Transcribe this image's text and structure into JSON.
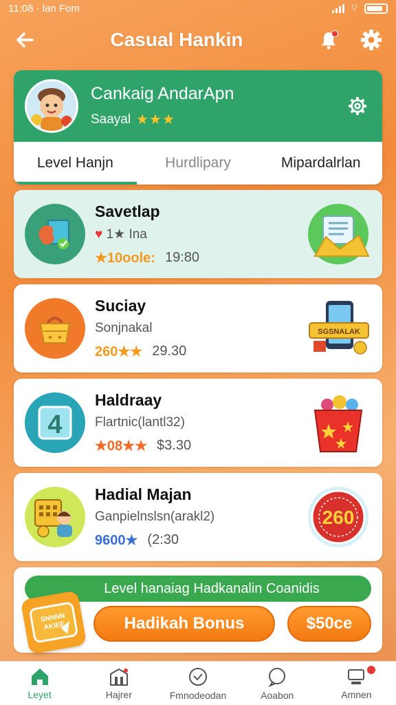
{
  "status_bar": {
    "time": "11:08 · lan Fom"
  },
  "app_bar": {
    "title": "Casual Hankin"
  },
  "profile": {
    "name": "Cankaig AndarApn",
    "subtitle": "Saayal",
    "stars": "★★★"
  },
  "tabs": [
    {
      "label": "Level Hanjn",
      "active": true
    },
    {
      "label": "Hurdlipary",
      "active": false
    },
    {
      "label": "Mipardalrlan",
      "active": false
    }
  ],
  "levels": [
    {
      "title": "Savetlap",
      "sub": "1★ Ina",
      "score": "★10oole:",
      "time": "19:80",
      "score_color": "#f39a1e"
    },
    {
      "title": "Suciay",
      "sub": "Sonjnakal",
      "score": "260★★",
      "time": "29.30",
      "score_color": "#f39a1e"
    },
    {
      "title": "Haldraay",
      "sub": "Flartnic(lantl32)",
      "score": "★08★★",
      "time": "$3.30",
      "score_color": "#f06a2a"
    },
    {
      "title": "Hadial Majan",
      "sub": "Ganpielnslsn(arakl2)",
      "score": "9600★",
      "time": "(2:30",
      "score_color": "#3a6fd8"
    }
  ],
  "bonus": {
    "banner": "Level hanaiag Hadkanalin Coanidis",
    "button": "Hadikah Bonus",
    "price": "$50ce",
    "badge_text": "SNNNN AKIEE",
    "reward_number": "260"
  },
  "nav": [
    {
      "label": "Leyet",
      "active": true
    },
    {
      "label": "Hajrer",
      "active": false
    },
    {
      "label": "Fmnodeodan",
      "active": false
    },
    {
      "label": "Aoabon",
      "active": false
    },
    {
      "label": "Amnen",
      "active": false
    }
  ],
  "colors": {
    "accent_green": "#2fa36a",
    "accent_orange": "#f47a12"
  }
}
